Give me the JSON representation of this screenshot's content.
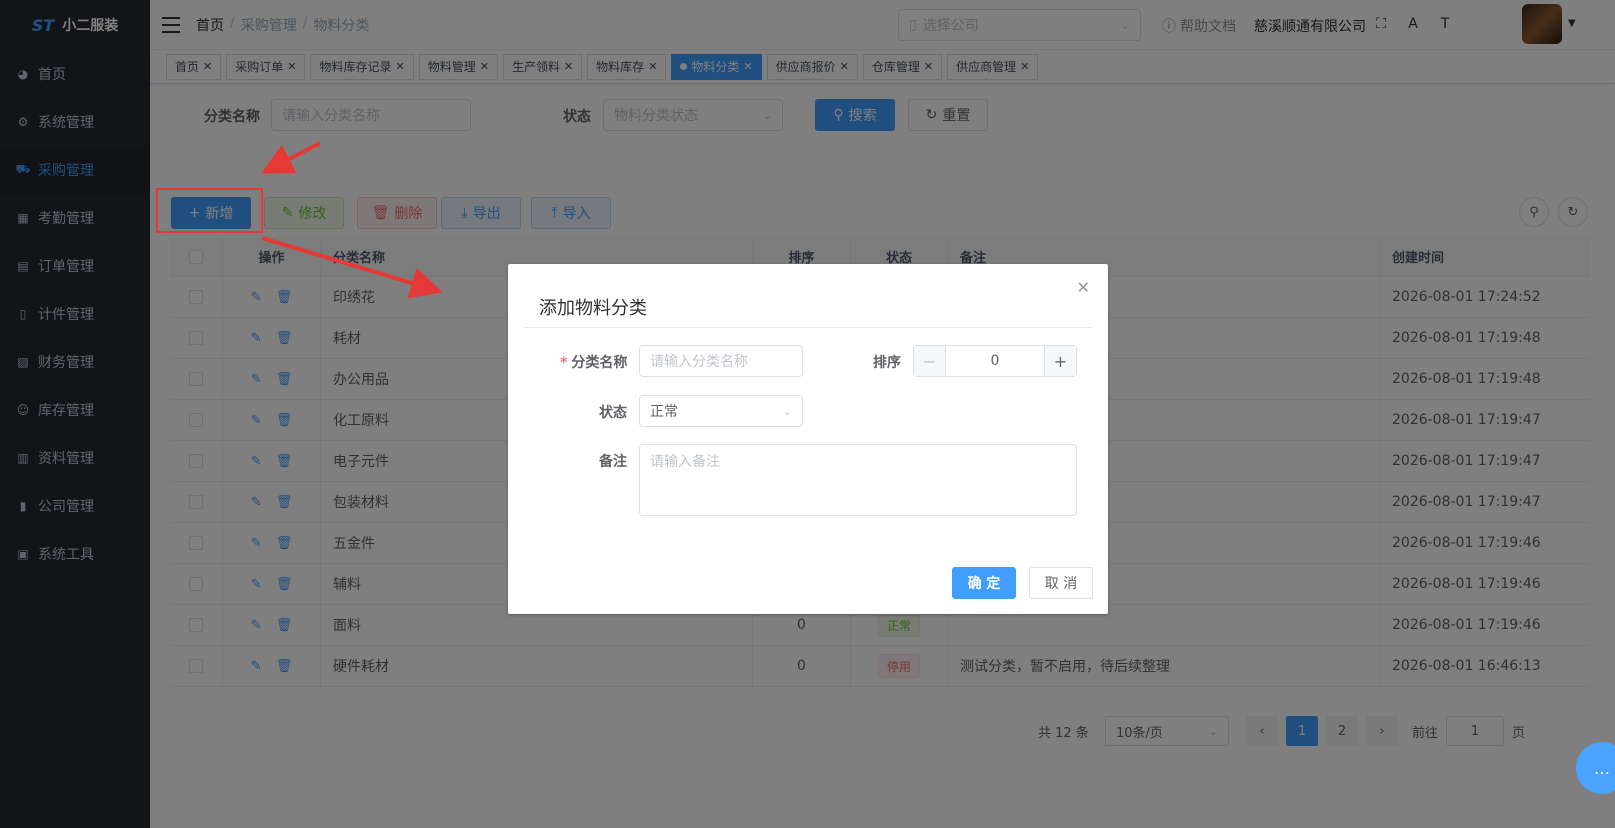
{
  "app": {
    "logo_text": "小二服装",
    "logo_mark": "ST"
  },
  "sidebar": {
    "items": [
      {
        "label": "首页",
        "icon": "dashboard-icon"
      },
      {
        "label": "系统管理",
        "icon": "gear-icon"
      },
      {
        "label": "采购管理",
        "icon": "cart-icon",
        "active": true
      },
      {
        "label": "考勤管理",
        "icon": "grid-icon"
      },
      {
        "label": "订单管理",
        "icon": "order-icon"
      },
      {
        "label": "计件管理",
        "icon": "book-icon"
      },
      {
        "label": "财务管理",
        "icon": "chart-icon"
      },
      {
        "label": "库存管理",
        "icon": "user-icon"
      },
      {
        "label": "资料管理",
        "icon": "document-icon"
      },
      {
        "label": "公司管理",
        "icon": "bar-chart-icon"
      },
      {
        "label": "系统工具",
        "icon": "toolbox-icon"
      }
    ]
  },
  "navbar": {
    "breadcrumb": [
      "首页",
      "采购管理",
      "物料分类"
    ],
    "company_select_placeholder": "选择公司",
    "help_label": "帮助文档",
    "company_name": "慈溪顺通有限公司"
  },
  "tags": [
    {
      "label": "首页"
    },
    {
      "label": "采购订单"
    },
    {
      "label": "物料库存记录"
    },
    {
      "label": "物料管理"
    },
    {
      "label": "生产领料"
    },
    {
      "label": "物料库存"
    },
    {
      "label": "物料分类",
      "active": true
    },
    {
      "label": "供应商报价"
    },
    {
      "label": "仓库管理"
    },
    {
      "label": "供应商管理"
    }
  ],
  "search": {
    "name_label": "分类名称",
    "name_placeholder": "请输入分类名称",
    "status_label": "状态",
    "status_placeholder": "物料分类状态",
    "search_btn": "搜索",
    "reset_btn": "重置"
  },
  "toolbar": {
    "add": "新增",
    "edit": "修改",
    "delete": "删除",
    "export": "导出",
    "import": "导入"
  },
  "table": {
    "headers": {
      "ops": "操作",
      "name": "分类名称",
      "sort": "排序",
      "status": "状态",
      "remark": "备注",
      "time": "创建时间"
    },
    "rows": [
      {
        "name": "印绣花",
        "sort": "",
        "status": "",
        "remark": "",
        "time": "2026-08-01 17:24:52"
      },
      {
        "name": "耗材",
        "sort": "",
        "status": "",
        "remark": "",
        "time": "2026-08-01 17:19:48"
      },
      {
        "name": "办公用品",
        "sort": "",
        "status": "",
        "remark": "",
        "time": "2026-08-01 17:19:48"
      },
      {
        "name": "化工原料",
        "sort": "",
        "status": "",
        "remark": "",
        "time": "2026-08-01 17:19:47"
      },
      {
        "name": "电子元件",
        "sort": "",
        "status": "",
        "remark": "",
        "time": "2026-08-01 17:19:47"
      },
      {
        "name": "包装材料",
        "sort": "",
        "status": "",
        "remark": "",
        "time": "2026-08-01 17:19:47"
      },
      {
        "name": "五金件",
        "sort": "",
        "status": "",
        "remark": "",
        "time": "2026-08-01 17:19:46"
      },
      {
        "name": "辅料",
        "sort": "",
        "status": "",
        "remark": "",
        "time": "2026-08-01 17:19:46"
      },
      {
        "name": "面料",
        "sort": "0",
        "status": "正常",
        "status_type": "ok",
        "remark": "",
        "time": "2026-08-01 17:19:46"
      },
      {
        "name": "硬件耗材",
        "sort": "0",
        "status": "停用",
        "status_type": "stop",
        "remark": "测试分类，暂不启用，待后续整理",
        "time": "2026-08-01 16:46:13"
      }
    ]
  },
  "pagination": {
    "total": "共 12 条",
    "page_size": "10条/页",
    "pages": [
      "1",
      "2"
    ],
    "current": "1",
    "goto_label": "前往",
    "goto_value": "1",
    "goto_suffix": "页"
  },
  "dialog": {
    "title": "添加物料分类",
    "name_label": "分类名称",
    "name_placeholder": "请输入分类名称",
    "sort_label": "排序",
    "sort_value": "0",
    "status_label": "状态",
    "status_value": "正常",
    "remark_label": "备注",
    "remark_placeholder": "请输入备注",
    "ok": "确 定",
    "cancel": "取 消"
  },
  "colors": {
    "primary": "#409eff",
    "sidebar_bg": "#24282e",
    "annotation_red": "#e53935",
    "success": "#67c23a",
    "danger": "#f56c6c"
  }
}
